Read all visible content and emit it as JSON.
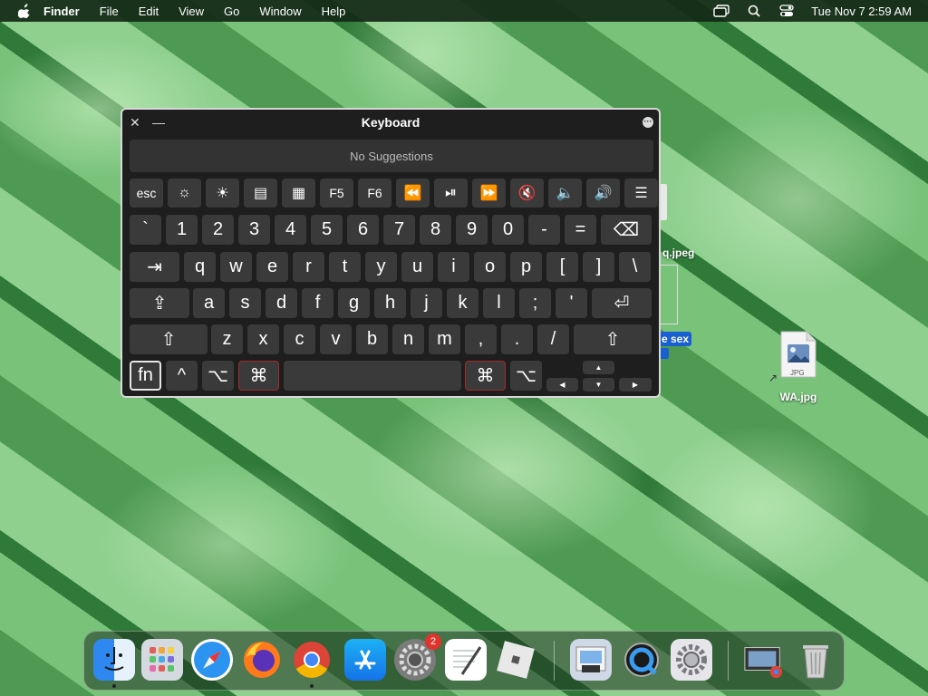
{
  "menubar": {
    "app_name": "Finder",
    "menus": [
      "File",
      "Edit",
      "View",
      "Go",
      "Window",
      "Help"
    ],
    "clock": "Tue Nov 7  2:59 AM"
  },
  "keyboard_window": {
    "title": "Keyboard",
    "suggestions": "No Suggestions",
    "fn_row": [
      "esc",
      "",
      "",
      "",
      "",
      "F5",
      "F6",
      "",
      "",
      "",
      "",
      "",
      "",
      ""
    ],
    "number_row": [
      "`",
      "1",
      "2",
      "3",
      "4",
      "5",
      "6",
      "7",
      "8",
      "9",
      "0",
      "-",
      "=",
      ""
    ],
    "q_row": [
      "",
      "q",
      "w",
      "e",
      "r",
      "t",
      "y",
      "u",
      "i",
      "o",
      "p",
      "[",
      "]",
      "\\"
    ],
    "a_row": [
      "",
      "a",
      "s",
      "d",
      "f",
      "g",
      "h",
      "j",
      "k",
      "l",
      ";",
      "'",
      ""
    ],
    "z_row": [
      "",
      "z",
      "x",
      "c",
      "v",
      "b",
      "n",
      "m",
      ",",
      ".",
      "/",
      ""
    ],
    "bottom_row": [
      "fn",
      "^",
      "⌥",
      "⌘",
      "",
      "⌘",
      "⌥"
    ]
  },
  "desktop": {
    "partial_label_1": "q.jpeg",
    "partial_label_2": "e sex",
    "file_name": "WA.jpg",
    "file_badge": "JPG"
  },
  "dock": {
    "badge_count": "2",
    "icons": [
      "finder-icon",
      "launchpad-icon",
      "safari-icon",
      "firefox-icon",
      "chrome-icon",
      "app-store-icon",
      "system-preferences-icon",
      "textedit-icon",
      "roblox-icon",
      "preview-icon",
      "quicktime-icon",
      "settings-icon",
      "downloads-stack-icon",
      "trash-icon"
    ]
  }
}
